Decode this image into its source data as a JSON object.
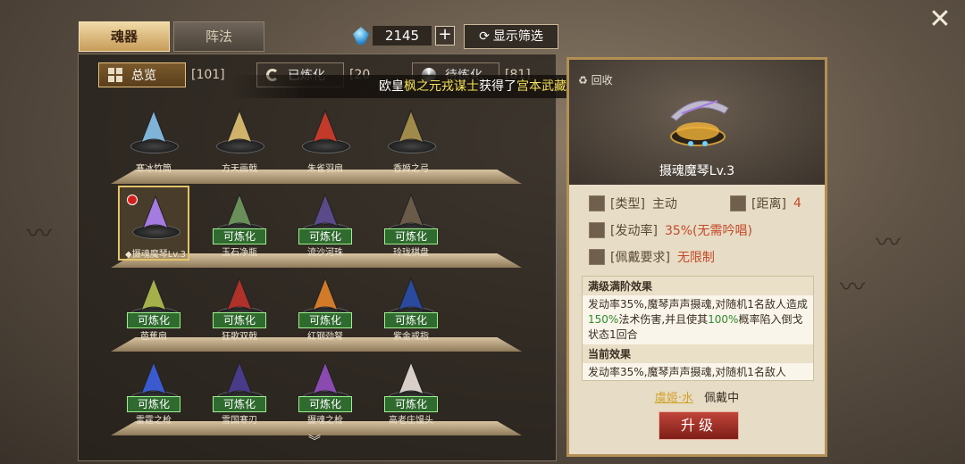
{
  "tabs": [
    {
      "label": "魂器",
      "active": true
    },
    {
      "label": "阵法",
      "active": false
    }
  ],
  "currency": {
    "icon": "blue-gem-icon",
    "value": "2145",
    "plus": "+"
  },
  "filter_button": {
    "label": "显示筛选",
    "icon": "refresh-icon"
  },
  "close_icon": "✕",
  "subtabs": [
    {
      "label": "总览",
      "count": "[101]",
      "icon": "grid-icon",
      "active": true
    },
    {
      "label": "已炼化",
      "count": "[20",
      "icon": "c-icon",
      "active": false
    },
    {
      "label": "待炼化",
      "count": "[81]",
      "icon": "swirl-icon",
      "active": false
    }
  ],
  "broadcast": {
    "prefix": "欧皇",
    "player": "枫之元戎谋士",
    "middle": "获得了",
    "item": "宫本武藏·水",
    "suffix": "!"
  },
  "items": [
    {
      "name": "寒冰竹筒",
      "tag": ""
    },
    {
      "name": "方天画戟",
      "tag": ""
    },
    {
      "name": "朱雀羽扇",
      "tag": ""
    },
    {
      "name": "香姬之弓",
      "tag": ""
    },
    {
      "name": "◆摄魂魔琴Lv.3",
      "tag": "",
      "selected": true
    },
    {
      "name": "玉石净瓶",
      "tag": "可炼化"
    },
    {
      "name": "流沙河珠",
      "tag": "可炼化"
    },
    {
      "name": "玲珑棋盘",
      "tag": "可炼化"
    },
    {
      "name": "芭蕉扇",
      "tag": "可炼化"
    },
    {
      "name": "狂歌双戟",
      "tag": "可炼化"
    },
    {
      "name": "红钢劲弩",
      "tag": "可炼化"
    },
    {
      "name": "紫金戒指",
      "tag": "可炼化"
    },
    {
      "name": "雷霆之枪",
      "tag": "可炼化"
    },
    {
      "name": "雪国寒刃",
      "tag": "可炼化"
    },
    {
      "name": "摄魂之枪",
      "tag": "可炼化"
    },
    {
      "name": "高老庄馒头",
      "tag": "可炼化"
    }
  ],
  "detail": {
    "recycle_label": "回收",
    "title": "摄魂魔琴Lv.3",
    "type_key": "[类型]",
    "type_val": "主动",
    "range_key": "[距离]",
    "range_val": "4",
    "rate_key": "[发动率]",
    "rate_val": "35%(无需吟唱)",
    "req_key": "[佩戴要求]",
    "req_val": "无限制",
    "max_header": "满级满阶效果",
    "max_text_a": "发动率35%,魔琴声声摄魂,对随机1名敌人造成",
    "max_pct1": "150%",
    "max_text_b": "法术伤害,并且使其",
    "max_pct2": "100%",
    "max_text_c": "概率陷入倒戈状态1回合",
    "cur_header": "当前效果",
    "cur_text": "发动率35%,魔琴声声摄魂,对随机1名敌人",
    "equipped_hero": "虞姬·水",
    "equipped_status": "佩戴中",
    "upgrade_label": "升级"
  }
}
